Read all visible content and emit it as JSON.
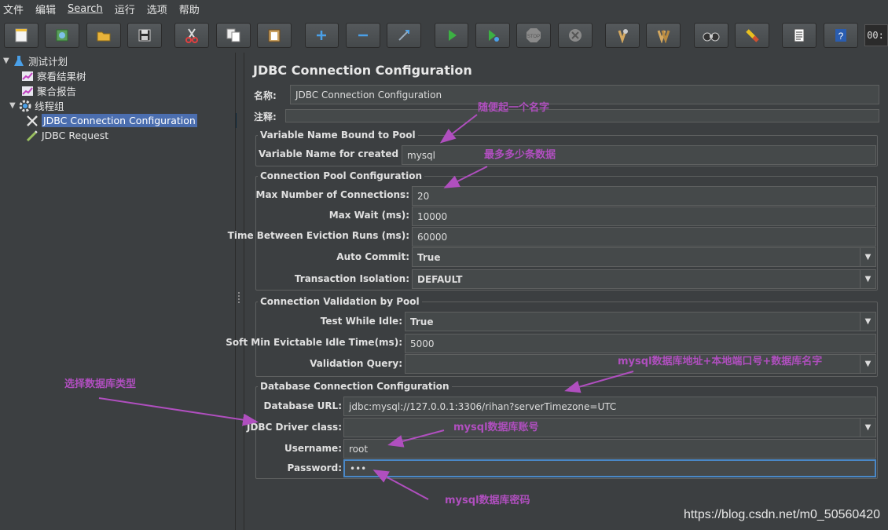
{
  "menu": [
    "文件",
    "编辑",
    "Search",
    "运行",
    "选项",
    "帮助"
  ],
  "toolbar": {
    "buttons": [
      "new-icon",
      "templates-icon",
      "open-icon",
      "save-icon",
      "cut-icon",
      "copy-icon",
      "paste-icon",
      "expand-icon",
      "collapse-icon",
      "toggle-icon",
      "start-icon",
      "start-no-pause-icon",
      "stop-icon",
      "shutdown-icon",
      "clear-icon",
      "clear-all-icon",
      "search-icon",
      "reset-search-icon",
      "function-helper-icon",
      "help-icon"
    ],
    "timer": "00:"
  },
  "tree": {
    "items": [
      {
        "label": "测试计划",
        "icon": "test-plan-icon",
        "expand": "▼",
        "level": 0
      },
      {
        "label": "察看结果树",
        "icon": "listener-icon",
        "level": 1
      },
      {
        "label": "聚合报告",
        "icon": "listener-icon",
        "level": 1
      },
      {
        "label": "线程组",
        "icon": "thread-group-icon",
        "expand": "▼",
        "level": 0
      },
      {
        "label": "JDBC Connection Configuration",
        "icon": "config-icon",
        "level": 1,
        "selected": true
      },
      {
        "label": "JDBC Request",
        "icon": "sampler-icon",
        "level": 1
      }
    ]
  },
  "main": {
    "title": "JDBC Connection Configuration",
    "name_label": "名称:",
    "name_value": "JDBC Connection Configuration",
    "comment_label": "注释:",
    "comment_value": "",
    "var_group": {
      "title": "Variable Name Bound to Pool",
      "pool_label": "Variable Name for created pool:",
      "pool_value": "mysql"
    },
    "pool_group": {
      "title": "Connection Pool Configuration",
      "max_conn_label": "Max Number of Connections:",
      "max_conn_value": "20",
      "max_wait_label": "Max Wait (ms):",
      "max_wait_value": "10000",
      "eviction_label": "Time Between Eviction Runs (ms):",
      "eviction_value": "60000",
      "auto_commit_label": "Auto Commit:",
      "auto_commit_value": "True",
      "isolation_label": "Transaction Isolation:",
      "isolation_value": "DEFAULT"
    },
    "validation_group": {
      "title": "Connection Validation by Pool",
      "test_idle_label": "Test While Idle:",
      "test_idle_value": "True",
      "soft_min_label": "Soft Min Evictable Idle Time(ms):",
      "soft_min_value": "5000",
      "query_label": "Validation Query:",
      "query_value": ""
    },
    "db_group": {
      "title": "Database Connection Configuration",
      "url_label": "Database URL:",
      "url_value": "jdbc:mysql://127.0.0.1:3306/rihan?serverTimezone=UTC",
      "driver_label": "JDBC Driver class:",
      "driver_value": "",
      "user_label": "Username:",
      "user_value": "root",
      "pass_label": "Password:",
      "pass_value": "•••"
    }
  },
  "annotations": {
    "name": "随便起一个名字",
    "max": "最多多少条数据",
    "url": "mysql数据库地址+本地端口号+数据库名字",
    "driver": "选择数据库类型",
    "user": "mysql数据库账号",
    "pass": "mysql数据库密码",
    "color": "#b04fbf"
  },
  "watermark": "https://blog.csdn.net/m0_50560420"
}
